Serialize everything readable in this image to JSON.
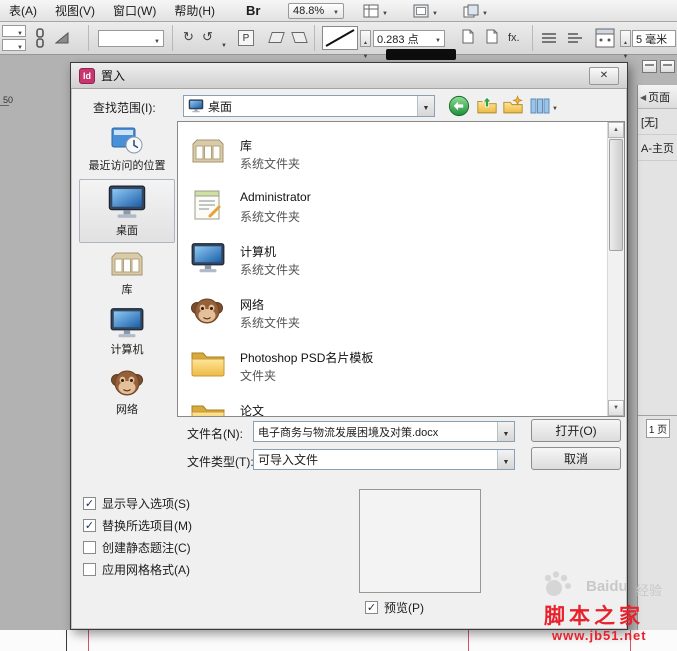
{
  "menubar": {
    "items": [
      {
        "label": "表(A)"
      },
      {
        "label": "视图(V)"
      },
      {
        "label": "窗口(W)"
      },
      {
        "label": "帮助(H)"
      }
    ],
    "bridge_label": "Br",
    "zoom_value": "48.8%"
  },
  "toolbar": {
    "stroke_weight": "0.283 点",
    "fx_label": "fx.",
    "grid_value": "5 毫米"
  },
  "ruler": {
    "mark": "50"
  },
  "pages_panel": {
    "tab_label": "页面",
    "masters": [
      {
        "label": "[无]"
      },
      {
        "label": "A-主页"
      }
    ],
    "status": "1 页"
  },
  "dialog": {
    "icon_text": "Id",
    "title": "置入",
    "look_in": {
      "label": "查找范围(I):",
      "value": "桌面"
    },
    "places": [
      {
        "label": "最近访问的位置"
      },
      {
        "label": "桌面"
      },
      {
        "label": "库"
      },
      {
        "label": "计算机"
      },
      {
        "label": "网络"
      }
    ],
    "files": [
      {
        "name": "库",
        "type": "系统文件夹"
      },
      {
        "name": "Administrator",
        "type": "系统文件夹"
      },
      {
        "name": "计算机",
        "type": "系统文件夹"
      },
      {
        "name": "网络",
        "type": "系统文件夹"
      },
      {
        "name": "Photoshop PSD名片模板",
        "type": "文件夹"
      },
      {
        "name": "论文",
        "type": ""
      }
    ],
    "file_name": {
      "label": "文件名(N):",
      "value": "电子商务与物流发展困境及对策.docx"
    },
    "file_type": {
      "label": "文件类型(T):",
      "value": "可导入文件"
    },
    "buttons": {
      "open": "打开(O)",
      "cancel": "取消"
    },
    "options": [
      {
        "label": "显示导入选项(S)",
        "mark": "✓"
      },
      {
        "label": "替换所选项目(M)",
        "mark": "✓"
      },
      {
        "label": "创建静态题注(C)",
        "mark": ""
      },
      {
        "label": "应用网格格式(A)",
        "mark": ""
      }
    ],
    "preview": {
      "label": "预览(P)",
      "mark": "✓"
    }
  },
  "watermark": {
    "logo_text": "Baidu",
    "logo_suffix": "经验",
    "site_name": "脚本之家",
    "site_url": "www.jb51.net"
  },
  "colors": {
    "watermark_red": "#e8222c",
    "folder_yellow": "#edba45",
    "screen_blue": "#1c5fa8",
    "dialog_bg": "#f0f0f0"
  }
}
